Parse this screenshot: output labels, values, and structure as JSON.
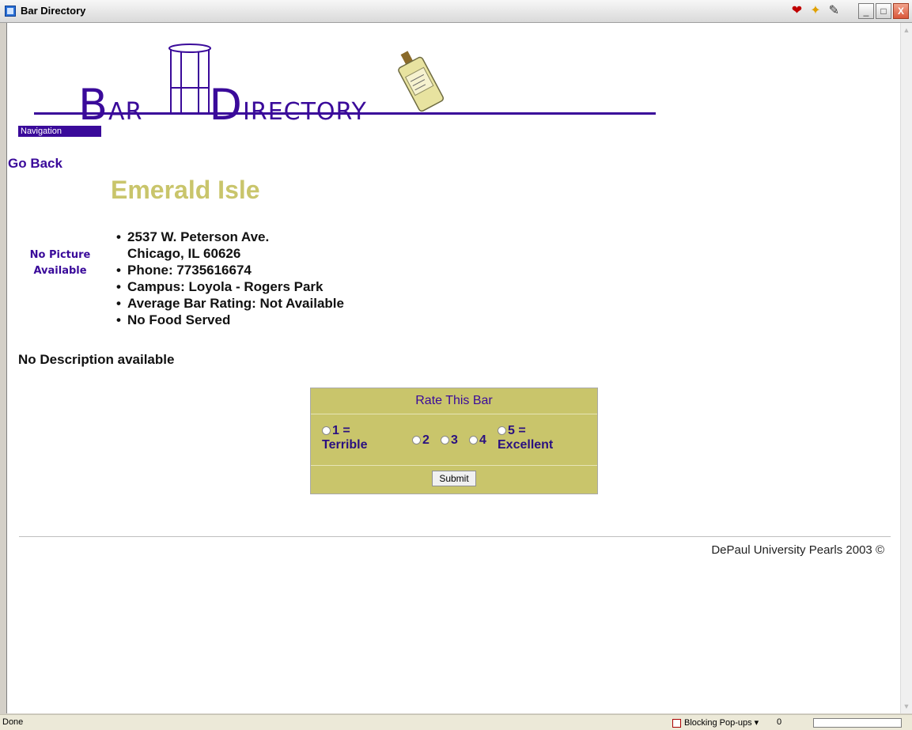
{
  "window": {
    "title": "Bar Directory"
  },
  "toolbar_icons": [
    "heart-icon",
    "star-add-icon",
    "edit-icon"
  ],
  "window_buttons": {
    "minimize": "_",
    "maximize": "□",
    "close": "X"
  },
  "logo": {
    "b": "B",
    "ar": "AR",
    "d": "D",
    "irectory": "IRECTORY"
  },
  "nav": {
    "label": "Navigation"
  },
  "go_back": "Go Back",
  "bar": {
    "name": "Emerald Isle",
    "no_picture": "No Picture Available",
    "address_line1": "2537 W. Peterson Ave.",
    "address_line2": "Chicago, IL 60626",
    "phone": "Phone: 7735616674",
    "campus": "Campus: Loyola - Rogers Park",
    "rating": "Average Bar Rating: Not Available",
    "food": "No Food Served",
    "description": "No Description available"
  },
  "rate": {
    "title": "Rate This Bar",
    "opt1": "1 =",
    "opt1_sub": "Terrible",
    "opt2": "2",
    "opt3": "3",
    "opt4": "4",
    "opt5": "5 =",
    "opt5_sub": "Excellent",
    "submit": "Submit"
  },
  "footer": "DePaul University Pearls 2003 ©",
  "statusbar": {
    "status": "Done",
    "popups": "Blocking Pop-ups",
    "count": "0"
  },
  "colors": {
    "accent": "#3a0a9a",
    "olive": "#c9c56b"
  }
}
